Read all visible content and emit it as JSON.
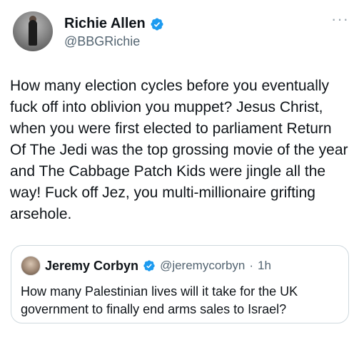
{
  "author": {
    "display_name": "Richie Allen",
    "handle": "@BBGRichie",
    "avatar_icon": "profile-photo"
  },
  "menu_icon": "more-options-icon",
  "tweet": {
    "text": "How many election cycles before you eventually fuck off into oblivion you muppet? Jesus Christ, when you were first elected to parliament Return Of The Jedi was the top grossing movie of the year and The Cabbage Patch Kids were jingle all the way! Fuck off Jez, you multi-millionaire grifting arsehole."
  },
  "quoted_tweet": {
    "display_name": "Jeremy Corbyn",
    "handle": "@jeremycorbyn",
    "separator": "·",
    "time": "1h",
    "text": "How many Palestinian lives will it take for the UK government to finally end arms sales to Israel?"
  },
  "colors": {
    "verified_badge": "#1d9bf0",
    "primary_text": "#0f1419",
    "secondary_text": "#536471",
    "border": "#cfd9de"
  }
}
